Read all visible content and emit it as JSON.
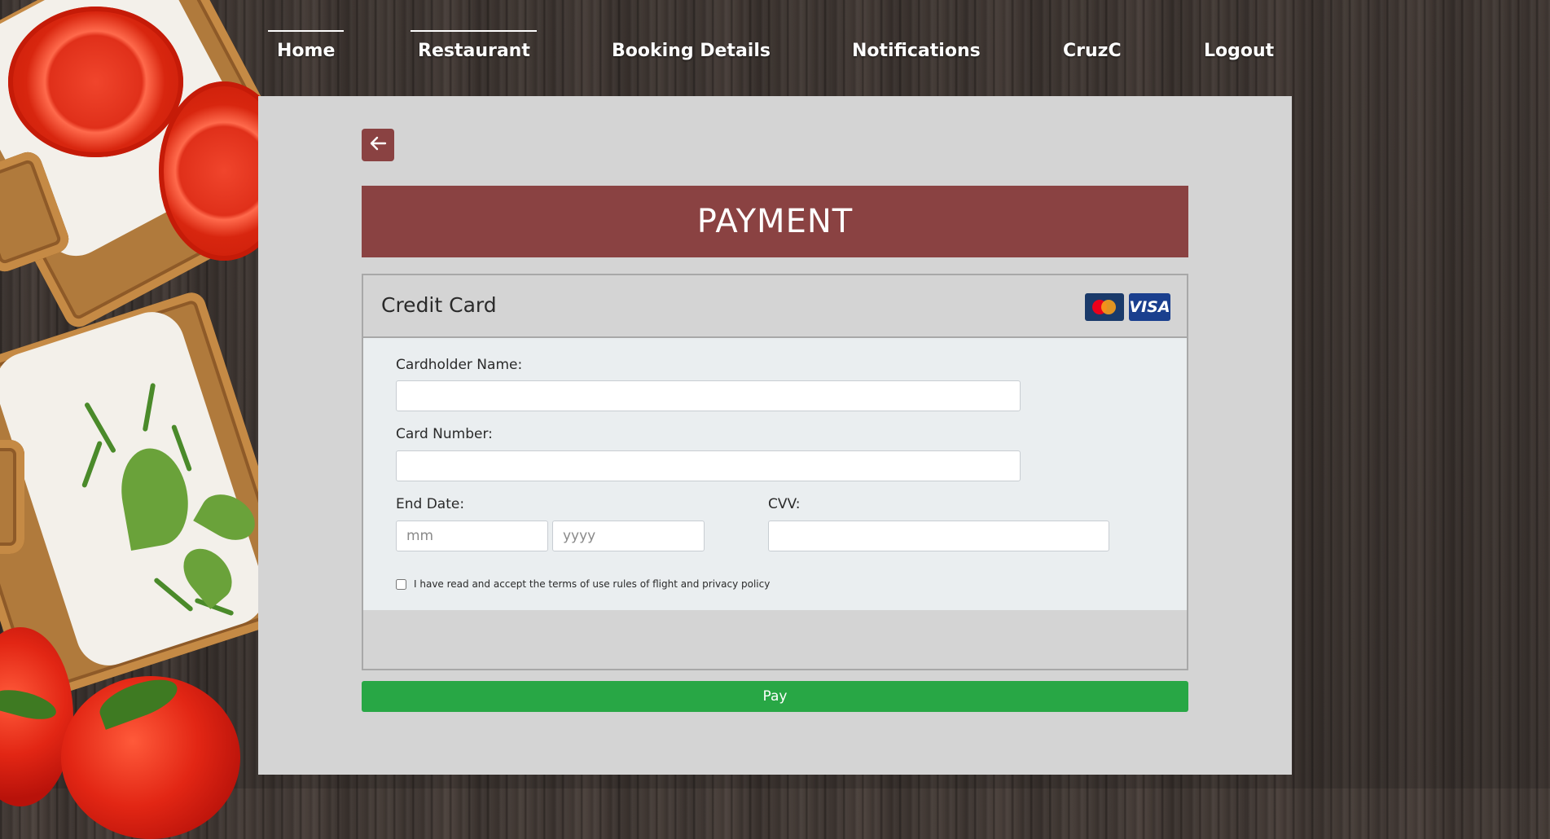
{
  "nav": {
    "items": [
      {
        "label": "Home"
      },
      {
        "label": "Restaurant"
      },
      {
        "label": "Booking Details"
      },
      {
        "label": "Notifications"
      },
      {
        "label": "CruzC"
      },
      {
        "label": "Logout"
      }
    ]
  },
  "page": {
    "back_icon": "arrow-left-icon",
    "title": "PAYMENT"
  },
  "card": {
    "title": "Credit Card",
    "logos": [
      "mastercard-icon",
      "VISA"
    ],
    "visa_text": "VISA",
    "fields": {
      "cardholder_label": "Cardholder Name:",
      "cardholder_value": "",
      "card_number_label": "Card Number:",
      "card_number_value": "",
      "end_date_label": "End Date:",
      "month_placeholder": "mm",
      "year_placeholder": "yyyy",
      "cvv_label": "CVV:",
      "cvv_value": ""
    },
    "terms_text": "I have read and accept the terms of use rules of flight and privacy policy",
    "terms_checked": false
  },
  "pay_button": "Pay",
  "colors": {
    "accent": "#8a4242",
    "pay": "#28a745",
    "panel": "#d4d4d4",
    "form_bg": "#eaeef0"
  }
}
